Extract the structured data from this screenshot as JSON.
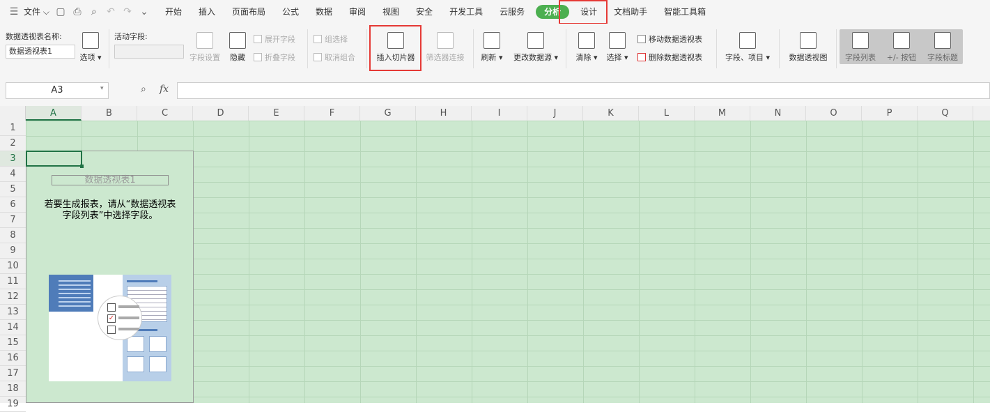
{
  "menubar": {
    "file_label": "文件",
    "tabs": [
      "开始",
      "插入",
      "页面布局",
      "公式",
      "数据",
      "审阅",
      "视图",
      "安全",
      "开发工具",
      "云服务",
      "分析",
      "设计",
      "文档助手",
      "智能工具箱"
    ],
    "active_tab": "分析"
  },
  "ribbon": {
    "pivot_name_label": "数据透视表名称:",
    "pivot_name_value": "数据透视表1",
    "options_label": "选项",
    "active_field_label": "活动字段:",
    "field_settings_label": "字段设置",
    "hide_label": "隐藏",
    "expand_field_label": "展开字段",
    "collapse_field_label": "折叠字段",
    "group_selection_label": "组选择",
    "ungroup_label": "取消组合",
    "insert_slicer_label": "插入切片器",
    "filter_connections_label": "筛选器连接",
    "refresh_label": "刷新",
    "change_source_label": "更改数据源",
    "clear_label": "清除",
    "select_label": "选择",
    "move_pivot_label": "移动数据透视表",
    "delete_pivot_label": "删除数据透视表",
    "fields_items_label": "字段、项目",
    "pivot_chart_label": "数据透视图",
    "field_list_label": "字段列表",
    "plus_minus_label": "+/- 按钮",
    "field_headers_label": "字段标题"
  },
  "formula_bar": {
    "name_box": "A3",
    "fx_label": "fx",
    "formula": ""
  },
  "columns": [
    "A",
    "B",
    "C",
    "D",
    "E",
    "F",
    "G",
    "H",
    "I",
    "J",
    "K",
    "L",
    "M",
    "N",
    "O",
    "P",
    "Q"
  ],
  "rows": [
    "1",
    "2",
    "3",
    "4",
    "5",
    "6",
    "7",
    "8",
    "9",
    "10",
    "11",
    "12",
    "13",
    "14",
    "15",
    "16",
    "17",
    "18",
    "19"
  ],
  "pivot": {
    "title": "数据透视表1",
    "hint_line1": "若要生成报表，请从“数据透视表",
    "hint_line2": "字段列表”中选择字段。"
  }
}
